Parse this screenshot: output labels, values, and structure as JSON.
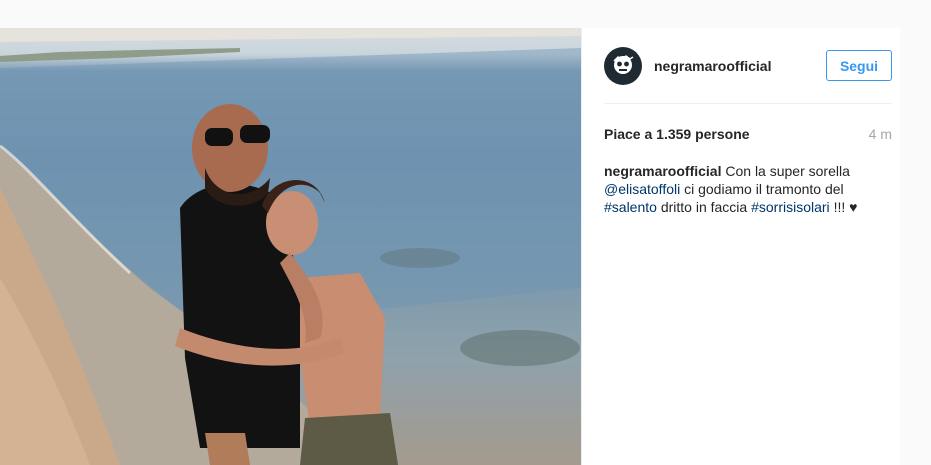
{
  "post": {
    "username": "negramaroofficial",
    "follow_label": "Segui",
    "likes": "Piace a 1.359 persone",
    "time": "4 m",
    "caption": {
      "user": "negramaroofficial",
      "text1": "Con la super sorella",
      "mention": "@elisatoffoli",
      "text2": "ci godiamo il tramonto del",
      "hashtag1": "#salento",
      "text3": "dritto in faccia",
      "hashtag2": "#sorrisisolari",
      "text4": "!!! ♥"
    }
  },
  "colors": {
    "accent": "#3897f0",
    "link": "#003569",
    "text": "#262626",
    "muted": "#a5a7aa"
  },
  "icons": {
    "avatar": "skull-logo-icon"
  }
}
